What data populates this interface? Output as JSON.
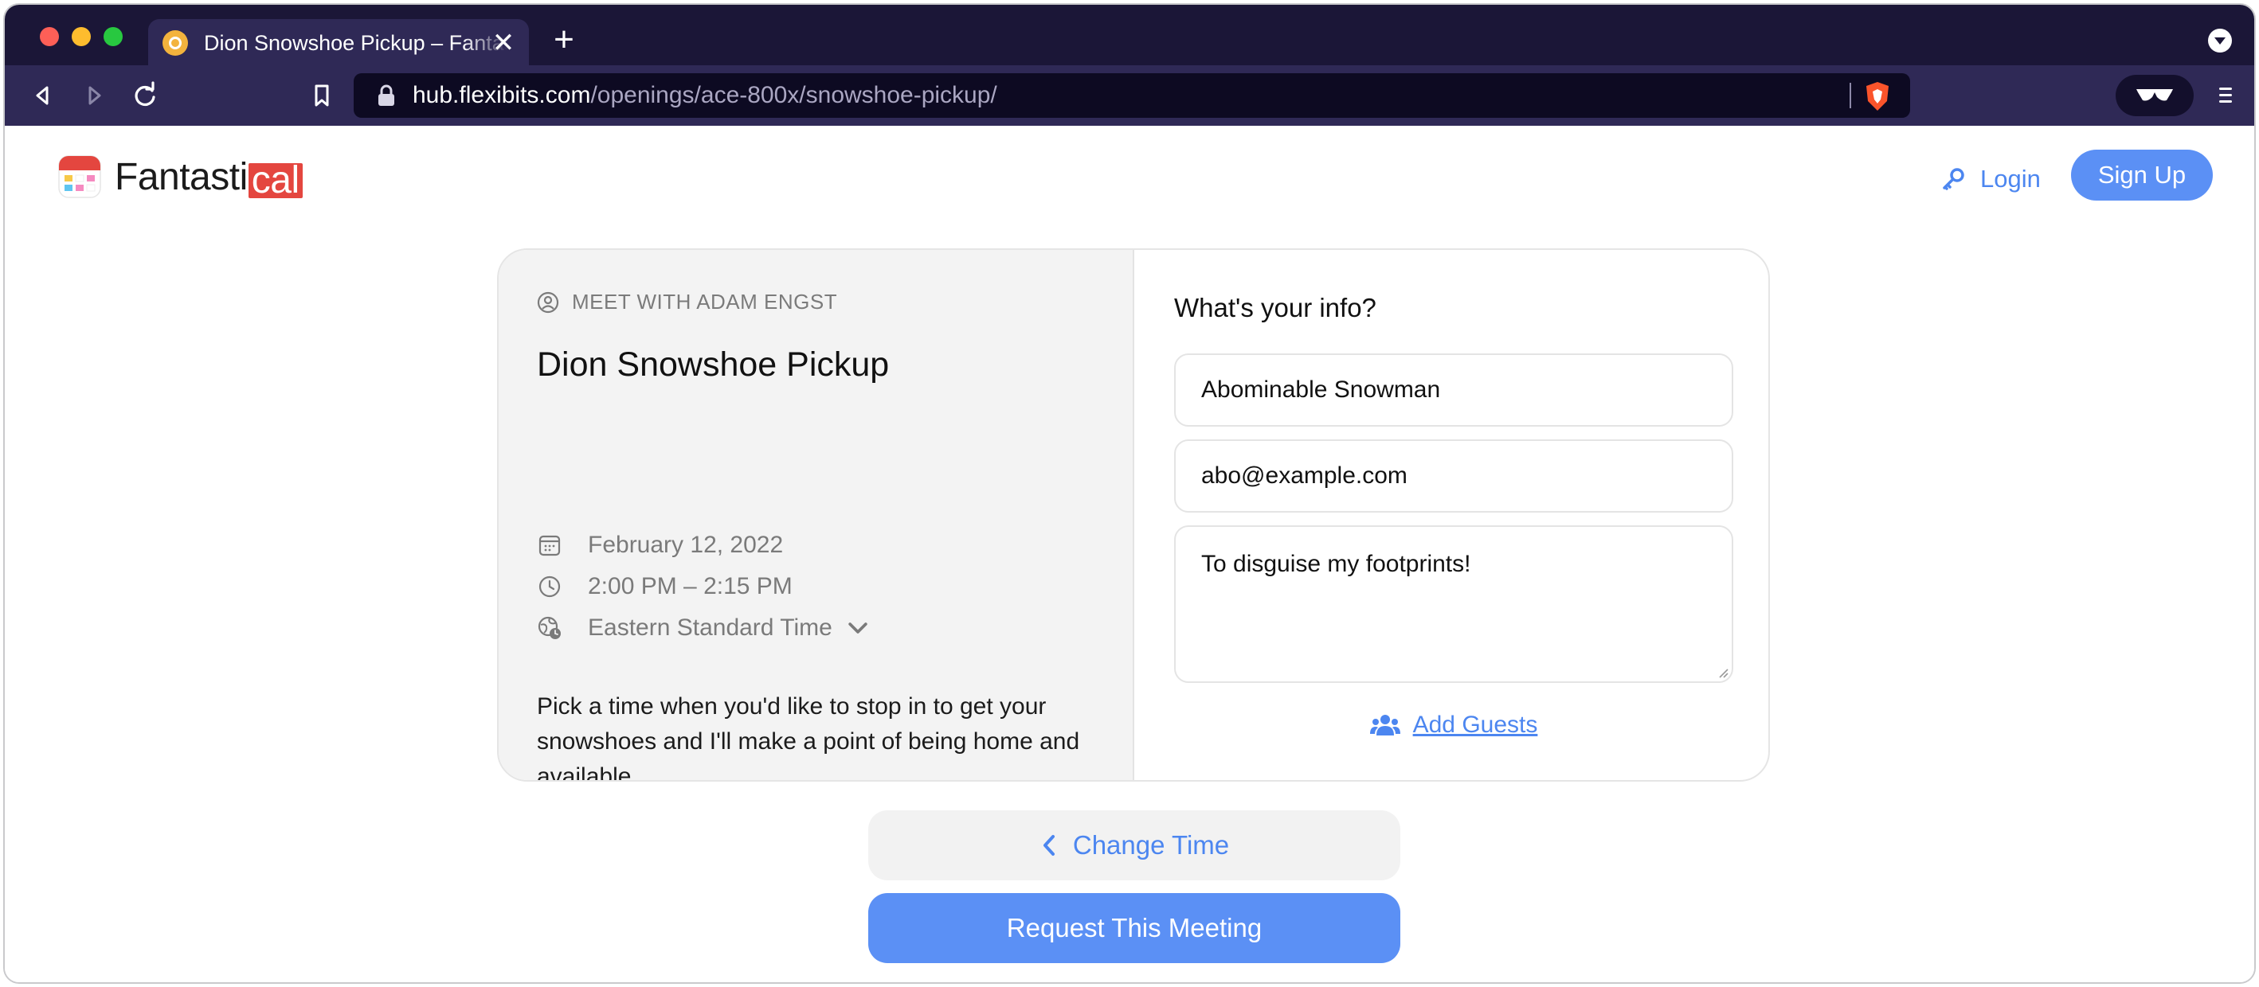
{
  "browser": {
    "tab_title": "Dion Snowshoe Pickup – Fantastical",
    "url_host": "hub.flexibits.com",
    "url_path": "/openings/ace-800x/snowshoe-pickup/",
    "new_tab_glyph": "+",
    "close_glyph": "✕"
  },
  "header": {
    "logo_text": "Fantasti",
    "logo_accent": "cal",
    "login_label": "Login",
    "signup_label": "Sign Up"
  },
  "event": {
    "meet_with": "MEET WITH ADAM ENGST",
    "title": "Dion Snowshoe Pickup",
    "date": "February 12, 2022",
    "time": "2:00 PM – 2:15 PM",
    "timezone": "Eastern Standard Time",
    "description": "Pick a time when you'd like to stop in to get your snowshoes and I'll make a point of being home and available."
  },
  "form": {
    "heading": "What's your info?",
    "name_value": "Abominable Snowman",
    "email_value": "abo@example.com",
    "note_value": "To disguise my footprints!",
    "add_guests_label": "Add Guests"
  },
  "actions": {
    "change_time_label": "Change Time",
    "request_label": "Request This Meeting"
  },
  "colors": {
    "accent": "#5b90f5",
    "link": "#4c86f0",
    "chrome_dark": "#1b1637",
    "chrome_toolbar": "#2f2956",
    "logo_red": "#e4463f"
  },
  "icons": {
    "back": "chevron-left-icon",
    "forward": "chevron-right-icon",
    "reload": "reload-icon",
    "bookmark": "bookmark-icon",
    "lock": "lock-icon",
    "shield": "brave-shield-icon",
    "reader": "reader-mode-icon",
    "menu": "hamburger-menu-icon",
    "login": "key-icon",
    "person": "person-circle-icon",
    "calendar": "calendar-icon",
    "clock": "clock-icon",
    "globe": "globe-clock-icon",
    "guests": "users-icon"
  }
}
